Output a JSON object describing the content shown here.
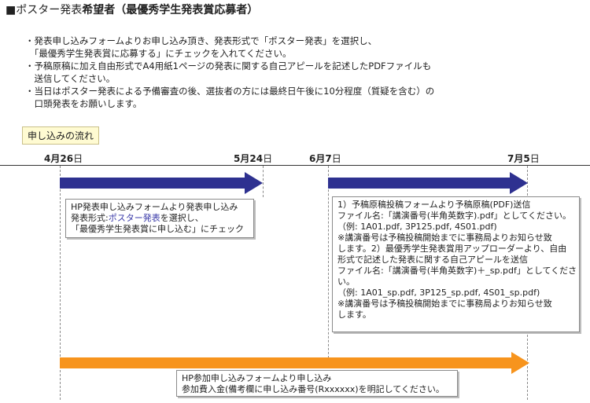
{
  "heading": {
    "prefix": "■ポスター発表",
    "bold": "希望者（最優秀学生発表賞応募者）"
  },
  "bullets": [
    "・発表申し込みフォームよりお申し込み頂き、発表形式で「ポスター発表」を選択し、",
    "　「最優秀学生発表賞に応募する」にチェックを入れてください。",
    "・予稿原稿に加え自由形式でA4用紙1ページの発表に関する自己アピールを記述したPDFファイルも",
    "　送信してください。",
    "・当日はポスター発表による予備審査の後、選抜者の方には最終日午後に10分程度（質疑を含む）の",
    "　口頭発表をお願いします。"
  ],
  "flow_label": "申し込みの流れ",
  "dates": [
    {
      "num": "4月26",
      "suffix": "日"
    },
    {
      "num": "5月24",
      "suffix": "日"
    },
    {
      "num": "6月7",
      "suffix": "日"
    },
    {
      "num": "7月5",
      "suffix": "日"
    }
  ],
  "box1": {
    "line1": "HP発表申し込みフォームより発表申し込み",
    "line2_pre": "発表形式:",
    "line2_link": "ポスター発表",
    "line2_post": "を選択し、",
    "line3": "「最優秀学生発表賞に申し込む」にチェック"
  },
  "box2": {
    "lines": [
      "1）予稿原稿投稿フォームより予稿原稿(PDF)送信",
      "ファイル名:「講演番号(半角英数字).pdf」としてください。",
      "（例: 1A01.pdf, 3P125.pdf, 4S01.pdf)",
      "※講演番号は予稿投稿開始までに事務局よりお知らせ致",
      "します。2）最優秀学生発表賞用アップローダーより、自由",
      "形式で記述した発表に関する自己アピールを送信",
      "ファイル名:「講演番号(半角英数字)＋_sp.pdf」としてくださ",
      "い。",
      "（例: 1A01_sp.pdf, 3P125_sp.pdf, 4S01_sp.pdf)",
      "※講演番号は予稿投稿開始までに事務局よりお知らせ致",
      "します。"
    ]
  },
  "box3": {
    "line1": "HP参加申し込みフォームより申し込み",
    "line2": "参加費入金(備考欄に申し込み番号(Rxxxxxx)を明記してください。"
  },
  "colors": {
    "navy_arrow": "#2e3190",
    "orange_arrow": "#f7941d",
    "flow_tag_bg": "#fffbd2",
    "link": "#3a3aa8"
  }
}
